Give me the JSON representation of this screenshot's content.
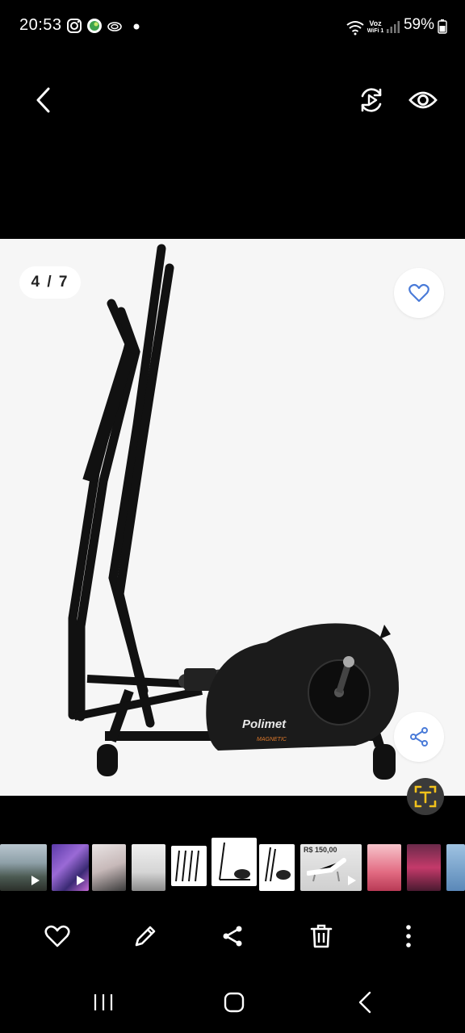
{
  "status_bar": {
    "time": "20:53",
    "notification_icons": [
      "instagram-icon",
      "whatsapp-icon",
      "cloud-icon",
      "dot-icon"
    ],
    "network_label_top": "Voz",
    "network_label_bottom": "WiFi 1",
    "battery": "59%"
  },
  "viewer": {
    "counter": "4 / 7",
    "image_brand": "Polimet",
    "image_subbrand": "MAGNETIC"
  },
  "filmstrip": {
    "active_index": 5,
    "price_thumb_text": "R$ 150,00",
    "thumb_count": 11
  },
  "bottom_bar": {
    "actions": [
      "favourite-icon",
      "edit-icon",
      "share-icon",
      "delete-icon",
      "more-icon"
    ]
  },
  "nav_bar": {
    "buttons": [
      "recents-icon",
      "home-icon",
      "back-icon"
    ]
  },
  "colors": {
    "background": "#000000",
    "viewer_bg": "#f6f6f6",
    "accent_blue": "#4a7bd8",
    "scan_yellow": "#f2c21b",
    "brand_orange": "#e07a2b"
  }
}
